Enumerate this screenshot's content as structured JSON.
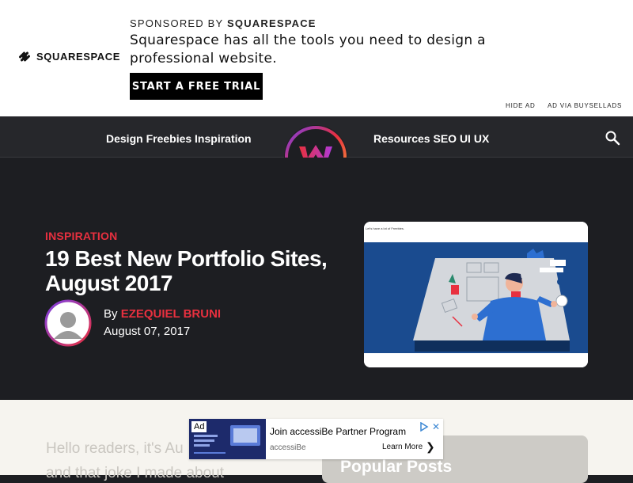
{
  "top_ad": {
    "sponsor_logo_text": "SQUARESPACE",
    "sponsored_prefix": "SPONSORED BY ",
    "sponsored_by": "SQUARESPACE",
    "copy": "Squarespace has all the tools you need to design a professional website.",
    "cta_label": "START A FREE TRIAL",
    "hide_ad": "HIDE AD",
    "ad_via": "AD VIA BUYSELLADS"
  },
  "nav": {
    "left_items": "Design Freebies Inspiration",
    "right_items": "Resources SEO UI UX",
    "logo_icon": "w-logo-icon",
    "search_icon": "search-icon"
  },
  "article": {
    "category": "INSPIRATION",
    "title": "19 Best New Portfolio Sites, August 2017",
    "by_label": "By ",
    "author": "EZEQUIEL BRUNI",
    "date": "August 07, 2017",
    "image_caption": "Let's have a lot of Freebies."
  },
  "body": {
    "intro_line_1": "Hello readers, it's Au",
    "intro_line_2": "and that joke I made about"
  },
  "sidebar": {
    "popular_title": "Popular Posts"
  },
  "native_ad": {
    "badge": "Ad",
    "headline": "Join accessiBe Partner Program",
    "sponsor": "accessiBe",
    "cta": "Learn More",
    "cta_arrow": "❯",
    "close_glyph": "✕"
  },
  "colors": {
    "accent_red": "#e8303f",
    "header_bg": "#26272b",
    "hero_bg": "#1d1e22",
    "content_bg": "#f6f4ef"
  }
}
